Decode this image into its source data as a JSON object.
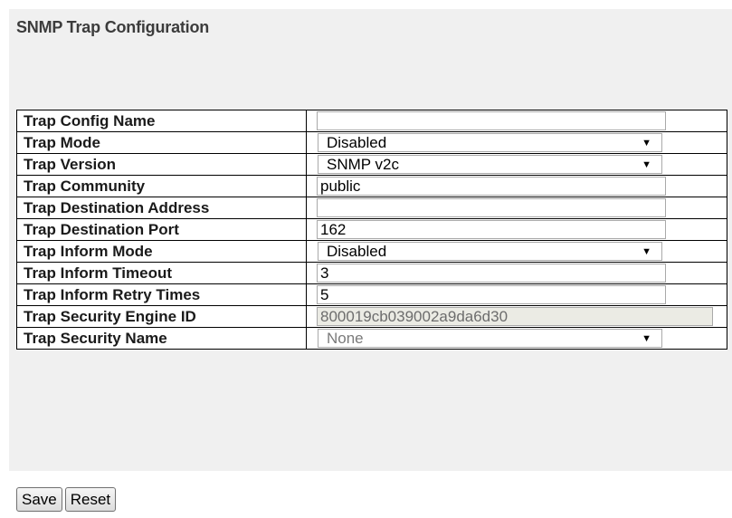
{
  "page": {
    "title": "SNMP Trap Configuration"
  },
  "rows": [
    {
      "label": "Trap Config Name",
      "value": ""
    },
    {
      "label": "Trap Mode",
      "value": "Disabled"
    },
    {
      "label": "Trap Version",
      "value": "SNMP v2c"
    },
    {
      "label": "Trap Community",
      "value": "public"
    },
    {
      "label": "Trap Destination Address",
      "value": ""
    },
    {
      "label": "Trap Destination Port",
      "value": "162"
    },
    {
      "label": "Trap Inform Mode",
      "value": "Disabled"
    },
    {
      "label": "Trap Inform Timeout",
      "value": "3"
    },
    {
      "label": "Trap Inform Retry Times",
      "value": "5"
    },
    {
      "label": "Trap Security Engine ID",
      "value": "800019cb039002a9da6d30"
    },
    {
      "label": "Trap Security Name",
      "value": "None"
    }
  ],
  "icons": {
    "dropdown": "triangle-down-icon"
  },
  "buttons": {
    "save": "Save",
    "reset": "Reset"
  }
}
